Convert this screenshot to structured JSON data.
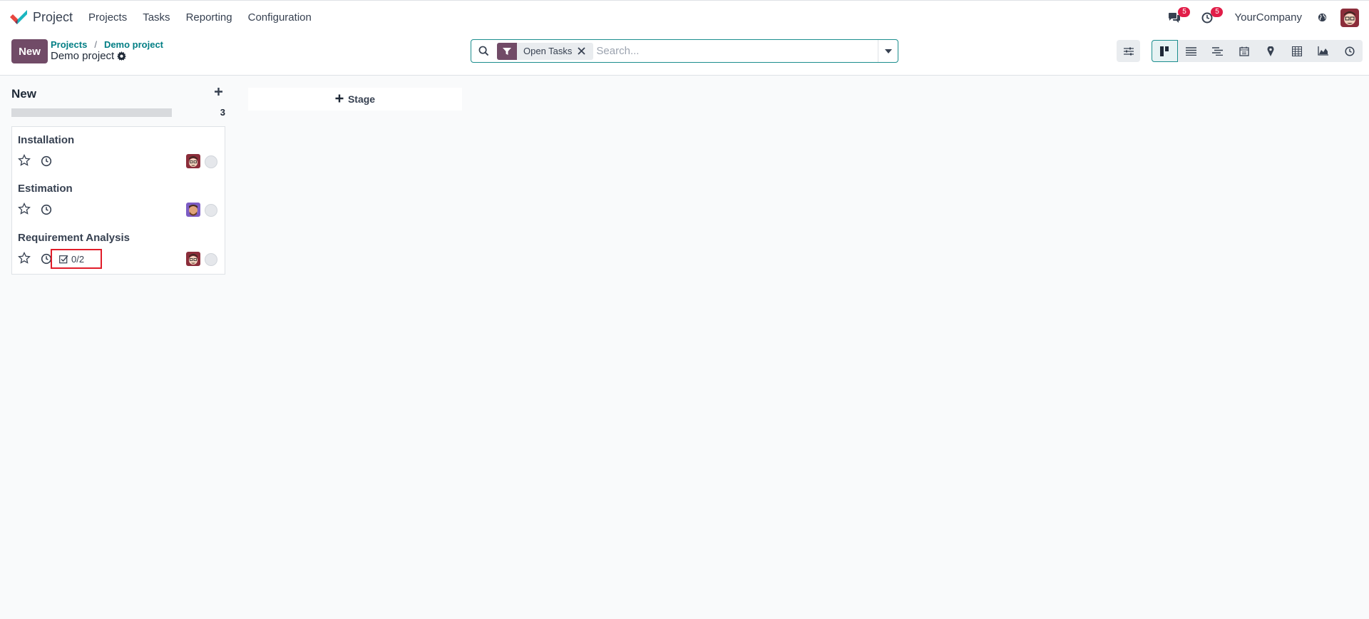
{
  "navbar": {
    "app_name": "Project",
    "menu": [
      "Projects",
      "Tasks",
      "Reporting",
      "Configuration"
    ],
    "messages_count": "5",
    "activities_count": "5",
    "company": "YourCompany",
    "icons": [
      "chat-icon",
      "clock-icon",
      "globe-icon"
    ]
  },
  "control_panel": {
    "new_label": "New",
    "breadcrumb": [
      "Projects",
      "Demo project"
    ],
    "current": "Demo project",
    "search": {
      "facet": "Open Tasks",
      "placeholder": "Search..."
    },
    "views": [
      "kanban",
      "list",
      "gantt",
      "calendar",
      "map",
      "pivot",
      "graph",
      "activity"
    ],
    "active_view": "kanban"
  },
  "kanban": {
    "column": {
      "title": "New",
      "count": "3",
      "cards": [
        {
          "title": "Installation",
          "subtasks": ""
        },
        {
          "title": "Estimation",
          "subtasks": ""
        },
        {
          "title": "Requirement Analysis",
          "subtasks": "0/2"
        }
      ]
    },
    "add_stage_label": "Stage"
  },
  "colors": {
    "primary": "#714b67",
    "accent": "#017e84",
    "badge": "#e11d48",
    "highlight": "#e11d2a"
  }
}
